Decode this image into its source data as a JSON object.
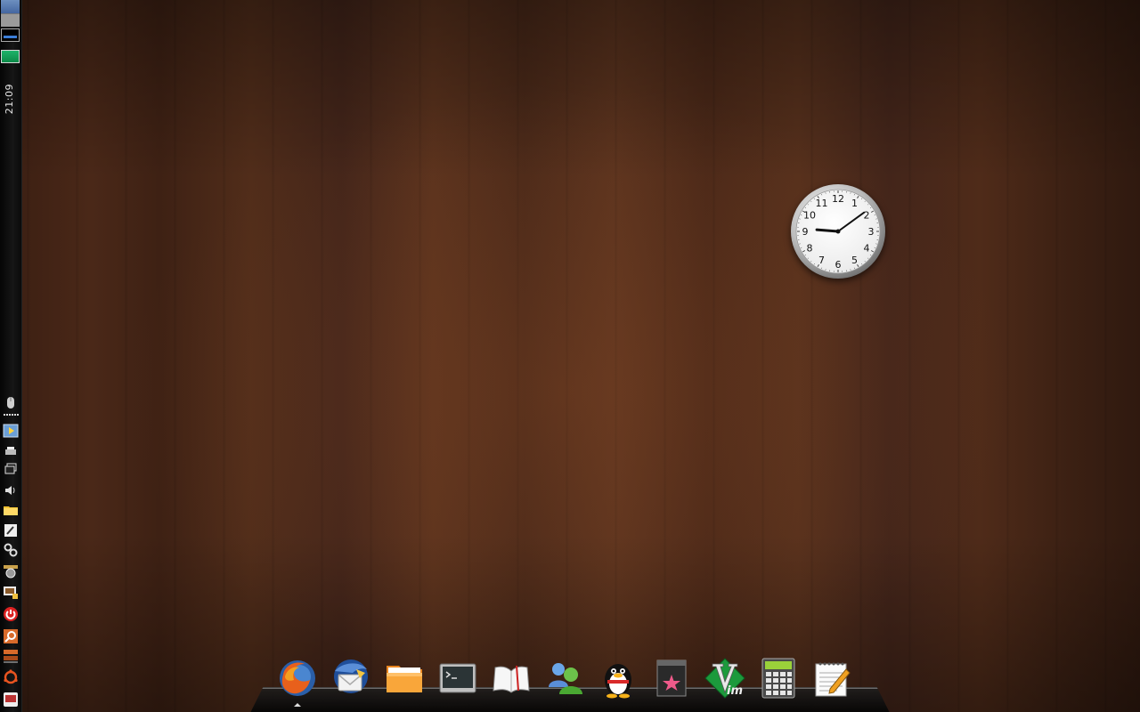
{
  "panel": {
    "clock": "21:09",
    "workspaces": [
      "Workspace 1",
      "Workspace 2",
      "Workspace 3",
      "Workspace 4"
    ],
    "tray_icons": [
      "mouse-icon",
      "grip-dots-icon",
      "media-player-icon",
      "printer-icon",
      "window-switch-icon",
      "speaker-icon",
      "folder-icon",
      "settings-tool-icon",
      "gears-icon",
      "system-settings-icon",
      "display-lock-icon",
      "power-icon",
      "search-icon",
      "stacked-windows-icon",
      "ubuntu-logo-icon",
      "show-desktop-icon"
    ]
  },
  "clock_widget": {
    "numerals": [
      "12",
      "1",
      "2",
      "3",
      "4",
      "5",
      "6",
      "7",
      "8",
      "9",
      "10",
      "11"
    ],
    "time": "21:09"
  },
  "dock": {
    "items": [
      {
        "name": "firefox",
        "icon": "firefox-icon",
        "running": true
      },
      {
        "name": "thunderbird",
        "icon": "thunderbird-icon",
        "running": false
      },
      {
        "name": "files",
        "icon": "folder-icon",
        "running": false
      },
      {
        "name": "terminal",
        "icon": "terminal-icon",
        "running": false
      },
      {
        "name": "dictionary",
        "icon": "book-icon",
        "running": false
      },
      {
        "name": "messenger",
        "icon": "contacts-icon",
        "running": false
      },
      {
        "name": "qq",
        "icon": "penguin-icon",
        "running": false
      },
      {
        "name": "media",
        "icon": "star-media-icon",
        "running": false
      },
      {
        "name": "vim",
        "icon": "vim-icon",
        "running": false
      },
      {
        "name": "calculator",
        "icon": "calculator-icon",
        "running": false
      },
      {
        "name": "text-editor",
        "icon": "notepad-icon",
        "running": false
      }
    ]
  },
  "colors": {
    "wallpaper": "#4a2818",
    "panel": "#111111",
    "workspace_active": "#5577aa"
  }
}
